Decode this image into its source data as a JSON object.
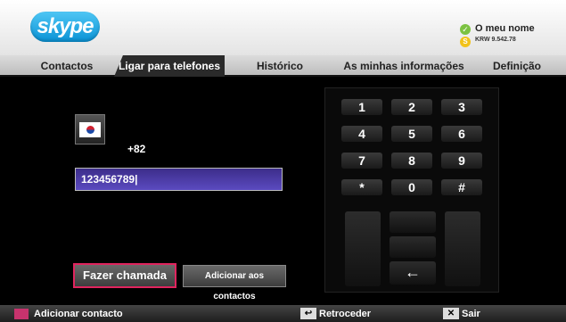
{
  "header": {
    "logo": "skype",
    "user_name": "O meu nome",
    "credit": "KRW 9.542.78",
    "status_icon": "check-icon",
    "credit_icon": "skype-credit-icon"
  },
  "tabs": [
    {
      "label": "Contactos"
    },
    {
      "label": "Ligar para telefones",
      "active": true
    },
    {
      "label": "Histórico"
    },
    {
      "label": "As minhas informações"
    },
    {
      "label": "Definição"
    }
  ],
  "dial": {
    "country_code": "+82",
    "flag": "south-korea-flag-icon",
    "number": "123456789|"
  },
  "actions": {
    "call": "Fazer chamada",
    "add": "Adicionar aos contactos"
  },
  "keypad": {
    "keys": [
      "1",
      "2",
      "3",
      "4",
      "5",
      "6",
      "7",
      "8",
      "9",
      "*",
      "0",
      "#"
    ],
    "backspace": "←"
  },
  "bottom": {
    "add_contact": "Adicionar contacto",
    "back": "Retroceder",
    "exit": "Sair",
    "back_icon": "↩",
    "exit_icon": "✕"
  }
}
